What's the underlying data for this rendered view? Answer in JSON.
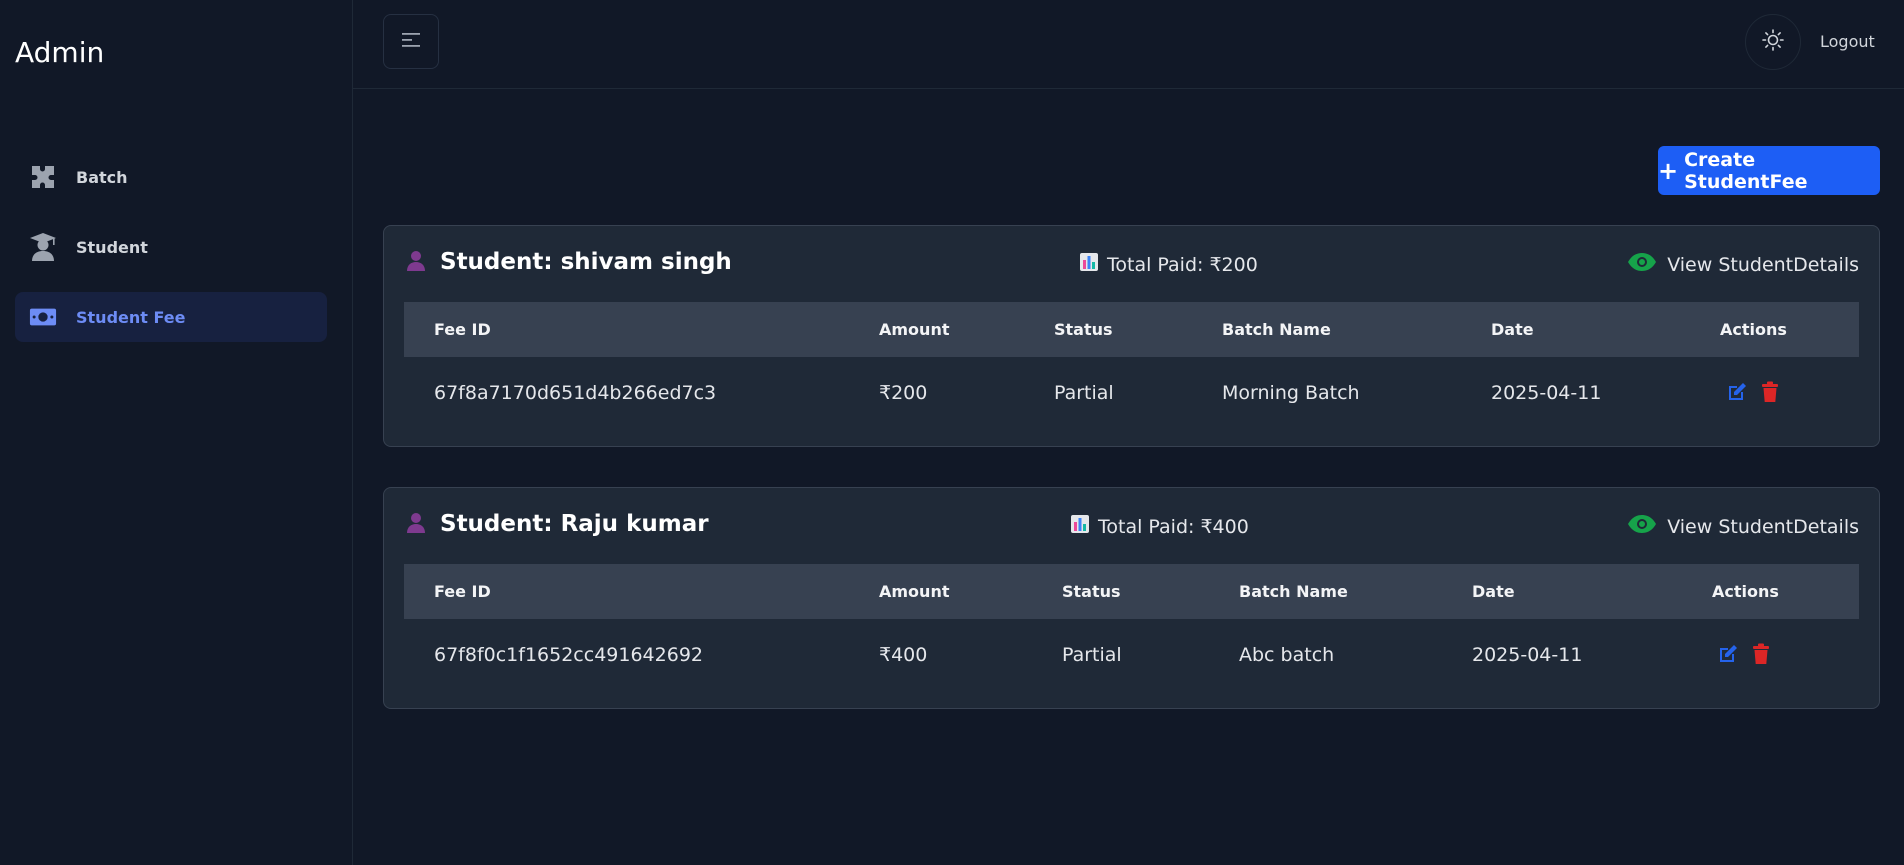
{
  "sidebar": {
    "brand": "Admin",
    "items": [
      {
        "label": "Batch",
        "icon": "puzzle-icon"
      },
      {
        "label": "Student",
        "icon": "graduate-icon"
      },
      {
        "label": "Student Fee",
        "icon": "money-icon"
      }
    ],
    "active": "Student Fee"
  },
  "header": {
    "menu_icon": "menu-icon",
    "theme_icon": "sun-icon",
    "logout": "Logout"
  },
  "main": {
    "create_button": "Create StudentFee",
    "columns": [
      "Fee ID",
      "Amount",
      "Status",
      "Batch Name",
      "Date",
      "Actions"
    ],
    "cards": [
      {
        "title": "Student: shivam singh",
        "total_paid": "Total Paid: ₹200",
        "view": "View StudentDetails",
        "rows": [
          {
            "fee_id": "67f8a7170d651d4b266ed7c3",
            "amount": "₹200",
            "status": "Partial",
            "batch": "Morning Batch",
            "date": "2025-04-11"
          }
        ]
      },
      {
        "title": "Student: Raju kumar",
        "total_paid": "Total Paid: ₹400",
        "view": "View StudentDetails",
        "rows": [
          {
            "fee_id": "67f8f0c1f1652cc491642692",
            "amount": "₹400",
            "status": "Partial",
            "batch": "Abc batch",
            "date": "2025-04-11"
          }
        ]
      }
    ]
  },
  "colors": {
    "background": "#111827",
    "card": "#1f2937",
    "table_header": "#374151",
    "primary": "#1d5ef5",
    "active_nav_text": "#6d8cf5",
    "view_icon": "#16a34a",
    "edit_icon": "#2563eb",
    "delete_icon": "#dc2626"
  }
}
